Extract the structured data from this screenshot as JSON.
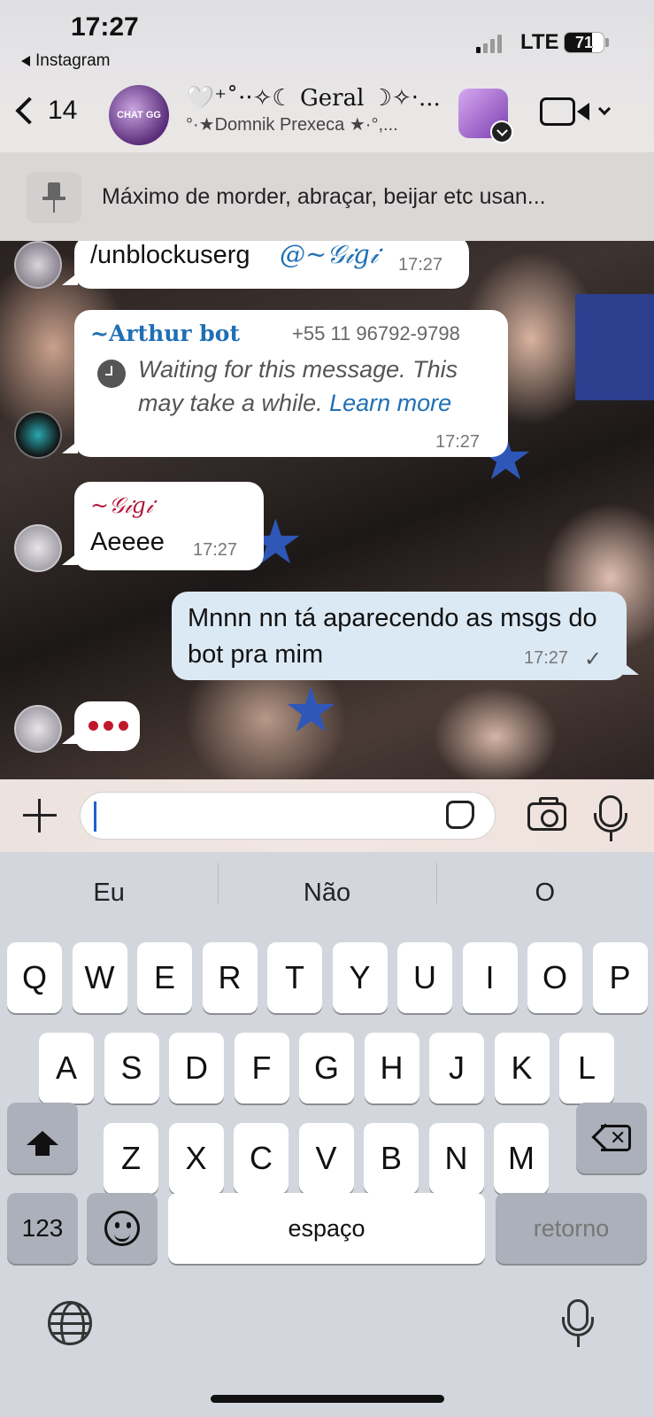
{
  "status_bar": {
    "time": "17:27",
    "back_app": "Instagram",
    "network": "LTE",
    "battery": "71",
    "battery_level": 0.71
  },
  "header": {
    "unread_count": "14",
    "avatar_text": "CHAT GG",
    "title": "🤍⁺˚·‧✧☾ Geral ☽✧‧...",
    "subtitle": "°·★Domnik Prexeca ★·°,..."
  },
  "pinned": {
    "text": "Máximo de morder, abraçar, beijar etc usan..."
  },
  "messages": [
    {
      "type": "in",
      "text": "/unblockuserg",
      "mention": "@~𝒢𝒾𝑔𝒾",
      "time": "17:27"
    },
    {
      "type": "in",
      "sender": "~Arthur bot",
      "phone": "+55 11 96792-9798",
      "waiting_text": "Waiting for this message. This may take a while.",
      "link": "Learn more",
      "time": "17:27"
    },
    {
      "type": "in",
      "sender": "~𝒢𝒾𝑔𝒾",
      "text": "Aeeee",
      "time": "17:27"
    },
    {
      "type": "out",
      "text": "Mnnn nn tá aparecendo as msgs do bot pra mim",
      "time": "17:27",
      "status": "✓"
    }
  ],
  "composer": {
    "placeholder": ""
  },
  "keyboard": {
    "suggestions": [
      "Eu",
      "Não",
      "O"
    ],
    "row1": [
      "Q",
      "W",
      "E",
      "R",
      "T",
      "Y",
      "U",
      "I",
      "O",
      "P"
    ],
    "row2": [
      "A",
      "S",
      "D",
      "F",
      "G",
      "H",
      "J",
      "K",
      "L"
    ],
    "row3": [
      "Z",
      "X",
      "C",
      "V",
      "B",
      "N",
      "M"
    ],
    "numbers": "123",
    "space": "espaço",
    "return": "retorno"
  },
  "colors": {
    "accent_blue": "#1f6fb5",
    "sender_arthur": "#1f6fb5",
    "sender_gigi": "#b0183e",
    "outgoing_bubble": "#dbe9f4"
  }
}
